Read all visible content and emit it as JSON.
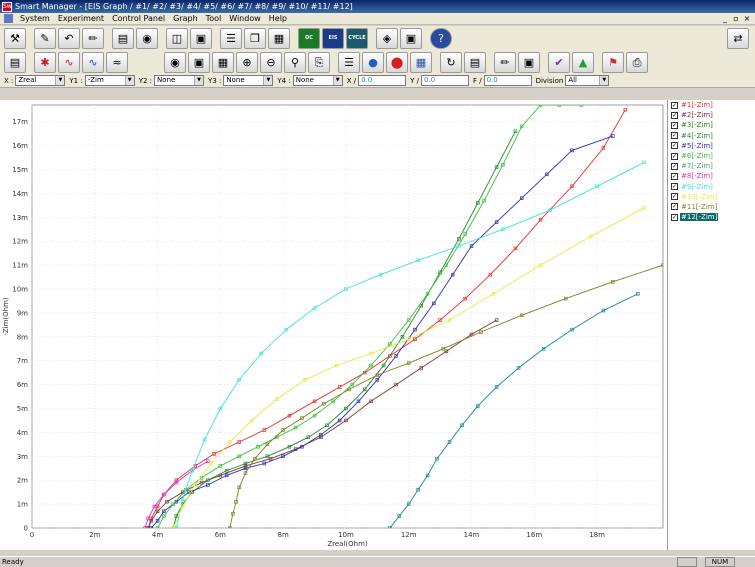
{
  "window": {
    "title": "Smart Manager - [EIS Graph / #1/ #2/ #3/ #4/ #5/ #6/ #7/ #8/ #9/ #10/ #11/ #12]",
    "icon_label": "Sw"
  },
  "menu": {
    "items": [
      "System",
      "Experiment",
      "Control Panel",
      "Graph",
      "Tool",
      "Window",
      "Help"
    ],
    "controls": [
      "_",
      "▫",
      "×"
    ]
  },
  "toolbar1": {
    "icons": [
      "tools-icon",
      "edit-icon",
      "undo-icon",
      "pencil-icon",
      "chart-icon",
      "glasses-icon",
      "panel-icon",
      "window-icon",
      "list-icon",
      "copy-icon",
      "table-icon",
      "dc-icon",
      "eis-icon",
      "cycle-icon",
      "palette-icon",
      "book-icon",
      "help-icon",
      "usb-icon"
    ],
    "labels": {
      "dc": "DC",
      "eis": "EIS",
      "cycle": "CYCLE",
      "help": "?"
    }
  },
  "toolbar2": {
    "icons": [
      "open-icon",
      "star-icon",
      "red-curve-icon",
      "blue-curve-icon",
      "wave-icon",
      "eye-icon",
      "zoom-fit-icon",
      "zoom-box-icon",
      "zoom-in-icon",
      "zoom-out-icon",
      "zoom-reset-icon",
      "export-icon",
      "legend-icon",
      "globe-icon",
      "stop-icon",
      "grid-icon",
      "rotate-icon",
      "report-icon",
      "pen-icon",
      "save-icon",
      "fit-icon",
      "ev-icon",
      "marker-icon",
      "print-icon"
    ]
  },
  "axisbar": {
    "x_label": "X :",
    "x_value": "Zreal",
    "y1_label": "Y1 :",
    "y1_value": "-Zim",
    "y2_label": "Y2 :",
    "y2_value": "None",
    "y3_label": "Y3 :",
    "y3_value": "None",
    "y4_label": "Y4 :",
    "y4_value": "None",
    "xcoord_label": "X /",
    "xcoord_value": "0.0",
    "ycoord_label": "Y /",
    "ycoord_value": "0.0",
    "f_label": "F /",
    "f_value": "0.0",
    "division_label": "Division",
    "division_value": "All"
  },
  "legend": {
    "items": [
      {
        "label": "#1[-Zim]",
        "color": "#e53030",
        "checked": true,
        "selected": false
      },
      {
        "label": "#2[-Zim]",
        "color": "#7a3a3a",
        "checked": true,
        "selected": false
      },
      {
        "label": "#3[-Zim]",
        "color": "#208a2a",
        "checked": true,
        "selected": false
      },
      {
        "label": "#4[-Zim]",
        "color": "#208a2a",
        "checked": true,
        "selected": false
      },
      {
        "label": "#5[-Zim]",
        "color": "#3030b0",
        "checked": true,
        "selected": false
      },
      {
        "label": "#6[-Zim]",
        "color": "#3ac03a",
        "checked": true,
        "selected": false
      },
      {
        "label": "#7[-Zim]",
        "color": "#4aa080",
        "checked": true,
        "selected": false
      },
      {
        "label": "#8[-Zim]",
        "color": "#d030d0",
        "checked": true,
        "selected": false
      },
      {
        "label": "#9[-Zim]",
        "color": "#40e0e0",
        "checked": true,
        "selected": false
      },
      {
        "label": "#10[-Zim]",
        "color": "#e8e840",
        "checked": true,
        "selected": false
      },
      {
        "label": "#11[-Zim]",
        "color": "#808020",
        "checked": true,
        "selected": false
      },
      {
        "label": "#12[-Zim]",
        "color": "#ffffff",
        "checked": true,
        "selected": true
      }
    ]
  },
  "status": {
    "text": "Ready",
    "num": "NUM"
  },
  "chart_data": {
    "type": "scatter",
    "xlabel": "Zreal(Ohm)",
    "ylabel": "-Zim(Ohm)",
    "xlim": [
      0,
      0.0201
    ],
    "ylim": [
      0,
      0.0177
    ],
    "xticks": [
      0,
      0.002,
      0.004,
      0.006,
      0.008,
      0.01,
      0.012,
      0.014,
      0.016,
      0.018
    ],
    "xtick_labels": [
      "0",
      "2m",
      "4m",
      "6m",
      "8m",
      "10m",
      "12m",
      "14m",
      "16m",
      "18m"
    ],
    "yticks": [
      0,
      0.001,
      0.002,
      0.003,
      0.004,
      0.005,
      0.006,
      0.007,
      0.008,
      0.009,
      0.01,
      0.011,
      0.012,
      0.013,
      0.014,
      0.015,
      0.016,
      0.017
    ],
    "ytick_labels": [
      "0",
      "1m",
      "2m",
      "3m",
      "4m",
      "5m",
      "6m",
      "7m",
      "8m",
      "9m",
      "10m",
      "11m",
      "12m",
      "13m",
      "14m",
      "15m",
      "16m",
      "17m"
    ],
    "grid": true,
    "series": [
      {
        "name": "#1[-Zim]",
        "color": "#e53030",
        "x": [
          0.0037,
          0.0038,
          0.004,
          0.0042,
          0.0046,
          0.0052,
          0.0058,
          0.0066,
          0.0074,
          0.0082,
          0.009,
          0.0098,
          0.0106,
          0.0114,
          0.0122,
          0.013,
          0.0138,
          0.0146,
          0.0154,
          0.0162,
          0.0172,
          0.0182,
          0.0189
        ],
        "y": [
          0.0,
          0.0004,
          0.0009,
          0.0014,
          0.002,
          0.0026,
          0.0031,
          0.0036,
          0.0041,
          0.0047,
          0.0053,
          0.0059,
          0.0065,
          0.0072,
          0.0079,
          0.0087,
          0.0096,
          0.0106,
          0.0117,
          0.0129,
          0.0143,
          0.0159,
          0.0175
        ]
      },
      {
        "name": "#2[-Zim]",
        "color": "#7a3a3a",
        "x": [
          0.0037,
          0.0038,
          0.004,
          0.0043,
          0.0048,
          0.0054,
          0.006,
          0.0068,
          0.0076,
          0.0084,
          0.0092,
          0.01,
          0.0108,
          0.0116,
          0.0124,
          0.0132,
          0.014,
          0.0148
        ],
        "y": [
          0.0,
          0.0003,
          0.0007,
          0.0011,
          0.0015,
          0.0019,
          0.0022,
          0.0026,
          0.0029,
          0.0033,
          0.0038,
          0.0045,
          0.0053,
          0.006,
          0.0067,
          0.0074,
          0.0081,
          0.0087
        ]
      },
      {
        "name": "#3[-Zim]",
        "color": "#208a2a",
        "x": [
          0.0045,
          0.0046,
          0.0048,
          0.0051,
          0.0056,
          0.0062,
          0.0068,
          0.0075,
          0.0082,
          0.0088,
          0.0094,
          0.01,
          0.0106,
          0.0112,
          0.0118,
          0.0124,
          0.013,
          0.0136,
          0.0142,
          0.0148,
          0.0154
        ],
        "y": [
          0.0,
          0.0005,
          0.001,
          0.0015,
          0.002,
          0.0024,
          0.0027,
          0.003,
          0.0034,
          0.0038,
          0.0043,
          0.005,
          0.0058,
          0.0068,
          0.008,
          0.0093,
          0.0107,
          0.0121,
          0.0136,
          0.0151,
          0.0166
        ]
      },
      {
        "name": "#5[-Zim]",
        "color": "#3030b0",
        "x": [
          0.0038,
          0.004,
          0.0042,
          0.0046,
          0.005,
          0.0056,
          0.0062,
          0.0068,
          0.0074,
          0.008,
          0.0086,
          0.0092,
          0.0098,
          0.0104,
          0.011,
          0.0116,
          0.0122,
          0.0128,
          0.0134,
          0.014,
          0.0148,
          0.0156,
          0.0164,
          0.0172,
          0.0185
        ],
        "y": [
          0.0,
          0.0003,
          0.0007,
          0.0011,
          0.0015,
          0.0018,
          0.0022,
          0.0025,
          0.0027,
          0.003,
          0.0034,
          0.0039,
          0.0045,
          0.0053,
          0.0062,
          0.0072,
          0.0083,
          0.0094,
          0.0106,
          0.0118,
          0.0128,
          0.0138,
          0.0148,
          0.0158,
          0.0164
        ]
      },
      {
        "name": "#6[-Zim]",
        "color": "#3ac03a",
        "x": [
          0.004,
          0.0042,
          0.0045,
          0.0049,
          0.0054,
          0.006,
          0.0066,
          0.0072,
          0.0078,
          0.0084,
          0.009,
          0.0096,
          0.0102,
          0.0108,
          0.0114,
          0.012,
          0.0126,
          0.0132,
          0.0138,
          0.0144,
          0.015,
          0.0156,
          0.0162,
          0.0168,
          0.0175
        ],
        "y": [
          0.0,
          0.0005,
          0.001,
          0.0016,
          0.0021,
          0.0026,
          0.003,
          0.0034,
          0.0038,
          0.0042,
          0.0047,
          0.0053,
          0.006,
          0.0068,
          0.0077,
          0.0087,
          0.0098,
          0.011,
          0.0123,
          0.0137,
          0.0152,
          0.0168,
          0.0177,
          0.0177,
          0.0177
        ]
      },
      {
        "name": "#8[-Zim]",
        "color": "#d030d0",
        "x": [
          0.0036,
          0.0037,
          0.0039,
          0.0042,
          0.0046,
          0.0051,
          0.0056
        ],
        "y": [
          0.0,
          0.0004,
          0.0009,
          0.0014,
          0.0019,
          0.0024,
          0.0028
        ]
      },
      {
        "name": "#9[-Zim]",
        "color": "#40e0e0",
        "x": [
          0.0046,
          0.0048,
          0.0051,
          0.0055,
          0.006,
          0.0066,
          0.0073,
          0.0081,
          0.009,
          0.01,
          0.0111,
          0.0123,
          0.0136,
          0.015,
          0.0165,
          0.018,
          0.0195
        ],
        "y": [
          0.0,
          0.0012,
          0.0024,
          0.0037,
          0.005,
          0.0062,
          0.0073,
          0.0083,
          0.0092,
          0.01,
          0.0106,
          0.0112,
          0.0118,
          0.0125,
          0.0133,
          0.0143,
          0.0153
        ]
      },
      {
        "name": "#10[-Zim]",
        "color": "#e8e840",
        "x": [
          0.0045,
          0.0048,
          0.0052,
          0.0057,
          0.0063,
          0.007,
          0.0078,
          0.0087,
          0.0097,
          0.0108,
          0.012,
          0.0133,
          0.0147,
          0.0162,
          0.0178,
          0.0195
        ],
        "y": [
          0.0,
          0.0009,
          0.0018,
          0.0027,
          0.0036,
          0.0045,
          0.0054,
          0.0062,
          0.0068,
          0.0073,
          0.0079,
          0.0087,
          0.0098,
          0.011,
          0.0122,
          0.0134
        ]
      },
      {
        "name": "#11[-Zim]",
        "color": "#808020",
        "x": [
          0.0063,
          0.0064,
          0.0065,
          0.0066,
          0.0068,
          0.0071,
          0.0075,
          0.008,
          0.0086,
          0.0093,
          0.0101,
          0.011,
          0.012,
          0.0131,
          0.0143,
          0.0156,
          0.017,
          0.0185,
          0.0201
        ],
        "y": [
          0.0,
          0.0006,
          0.0011,
          0.0017,
          0.0023,
          0.0029,
          0.0035,
          0.0041,
          0.0046,
          0.0052,
          0.0058,
          0.0064,
          0.0069,
          0.0075,
          0.0082,
          0.0089,
          0.0096,
          0.0103,
          0.011
        ]
      },
      {
        "name": "#12[-Zim]",
        "color": "#1a8a8a",
        "x": [
          0.0114,
          0.0117,
          0.012,
          0.0123,
          0.0126,
          0.0129,
          0.0133,
          0.0137,
          0.0142,
          0.0148,
          0.0155,
          0.0163,
          0.0172,
          0.0182,
          0.0193
        ],
        "y": [
          0.0,
          0.0005,
          0.001,
          0.0016,
          0.0022,
          0.0029,
          0.0036,
          0.0043,
          0.0051,
          0.0059,
          0.0067,
          0.0075,
          0.0083,
          0.0091,
          0.0098
        ]
      }
    ]
  }
}
